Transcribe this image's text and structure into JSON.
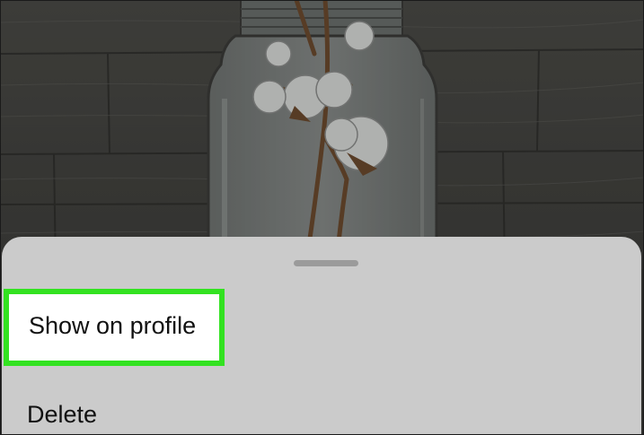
{
  "bottom_sheet": {
    "items": [
      {
        "label": "Show on profile",
        "highlighted": true
      },
      {
        "label": "Delete",
        "highlighted": false
      }
    ]
  },
  "colors": {
    "sheet_background": "#cbcbcb",
    "highlight_border": "#33e221",
    "highlight_fill": "#ffffff",
    "drag_handle": "#9b9b9b"
  },
  "background_image": {
    "subject": "cotton stems in a glass mason jar on a weathered wood background"
  }
}
